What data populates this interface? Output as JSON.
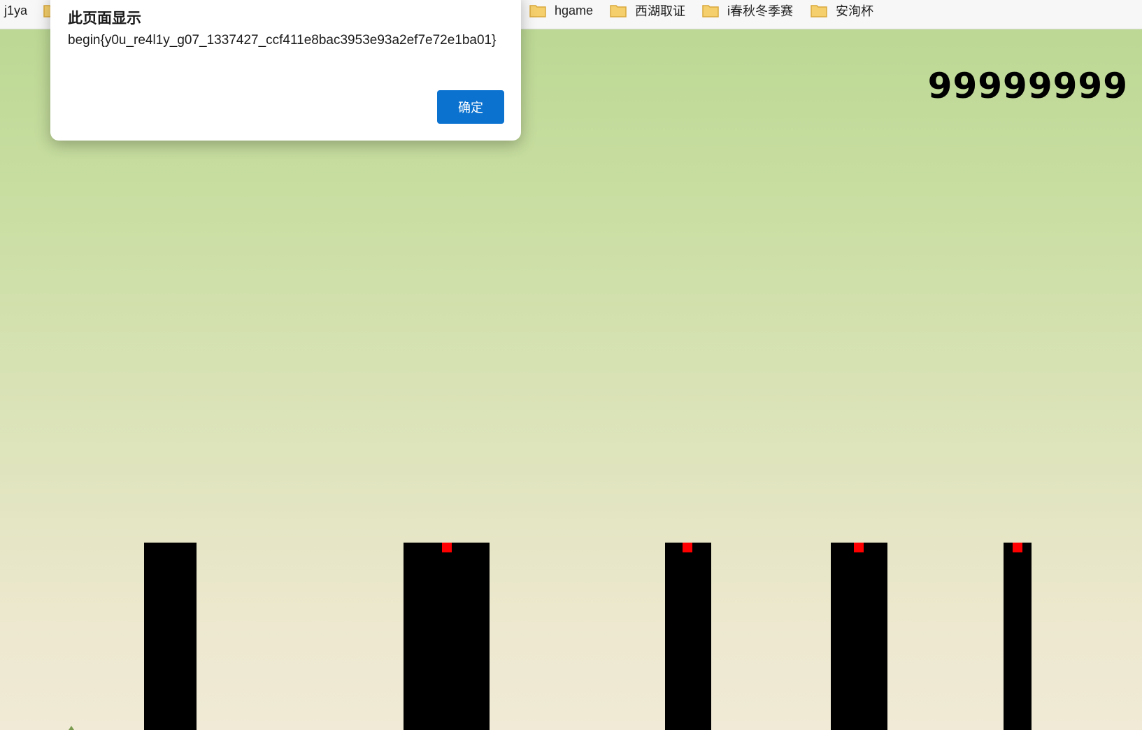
{
  "bookmarks": [
    {
      "label": "j1ya",
      "icon": "none"
    },
    {
      "label": "",
      "icon": "folder-icon"
    },
    {
      "label": "hgame",
      "icon": "folder-icon"
    },
    {
      "label": "西湖取证",
      "icon": "folder-icon"
    },
    {
      "label": "i春秋冬季赛",
      "icon": "folder-icon"
    },
    {
      "label": "安洵杯",
      "icon": "folder-icon"
    }
  ],
  "game": {
    "score": "99999999"
  },
  "alert": {
    "title": "此页面显示",
    "message": "begin{y0u_re4l1y_g07_1337427_ccf411e8bac3953e93a2ef7e72e1ba01}",
    "ok_label": "确定"
  },
  "colors": {
    "folder": "#f5cf6b",
    "folder_stroke": "#d9a83c",
    "button": "#0b72d0",
    "pillar": "#000000",
    "marker": "#ff0000"
  }
}
